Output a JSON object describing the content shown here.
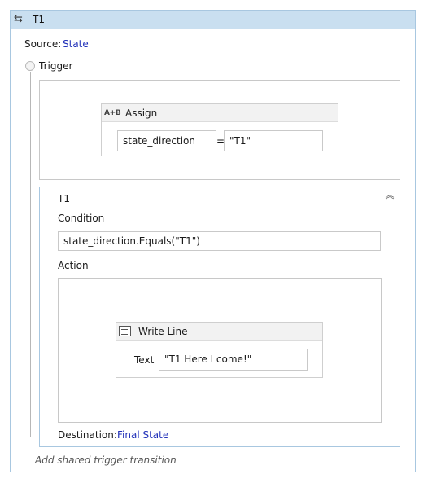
{
  "card": {
    "title": "T1",
    "icon": "transition-arrows-icon",
    "source_label": "Source: ",
    "source_value": "State",
    "trigger_label": "Trigger",
    "add_shared_label": "Add shared trigger transition"
  },
  "trigger": {
    "assign": {
      "icon": "assign-icon",
      "icon_text": "A+B",
      "title": "Assign",
      "to": "state_direction",
      "operator": "=",
      "value": "\"T1\""
    }
  },
  "transition": {
    "name": "T1",
    "collapse_icon": "double-chevron-up-icon",
    "condition_label": "Condition",
    "condition_value": "state_direction.Equals(\"T1\")",
    "action_label": "Action",
    "write_line": {
      "icon": "write-line-icon",
      "title": "Write Line",
      "text_label": "Text",
      "text_value": "\"T1 Here I come!\""
    },
    "destination_label": "Destination: ",
    "destination_value": "Final State"
  },
  "colors": {
    "header_bg": "#c9dff0",
    "border_blue": "#a8c7e0",
    "link": "#1f2fb8"
  }
}
